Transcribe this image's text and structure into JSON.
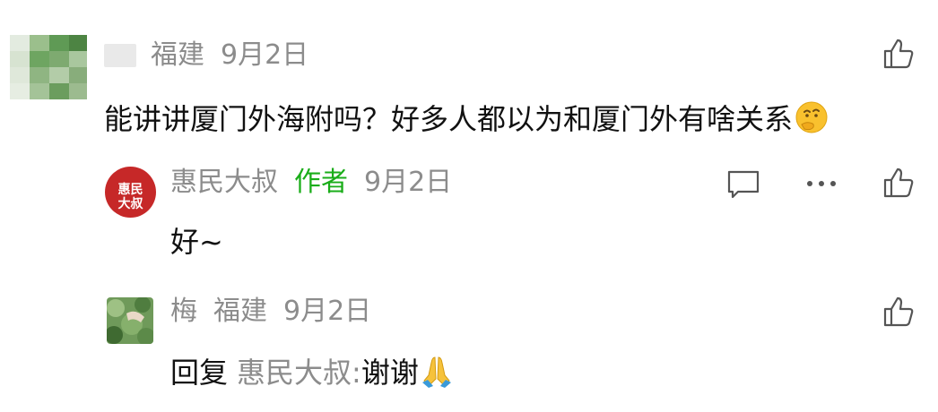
{
  "comments": [
    {
      "location": "福建",
      "date": "9月2日",
      "text": "能讲讲厦门外海附吗？好多人都以为和厦门外有啥关系",
      "emoji_icon": "thinking-face-icon"
    },
    {
      "avatar_text": [
        "惠民",
        "大叔"
      ],
      "name": "惠民大叔",
      "tag": "作者",
      "date": "9月2日",
      "text": "好~"
    },
    {
      "name": "梅",
      "location": "福建",
      "date": "9月2日",
      "reply_prefix": "回复",
      "reply_to": "惠民大叔:",
      "text": "谢谢",
      "emoji_icon": "folded-hands-icon"
    }
  ],
  "colors": {
    "meta": "#8c8c8c",
    "text": "#111111",
    "author_tag": "#1aad19",
    "avatar_red": "#c62828"
  }
}
